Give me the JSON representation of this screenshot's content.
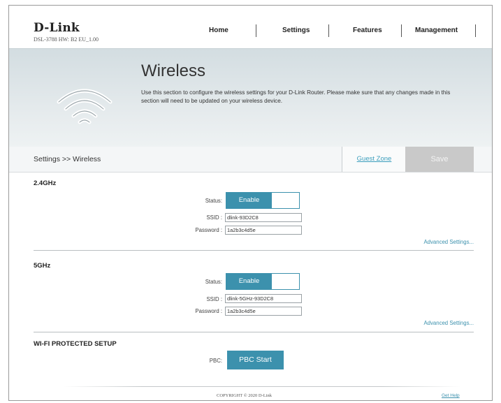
{
  "brand": {
    "logo": "D-Link",
    "model": "DSL-3788  HW: B2  EU_1.00"
  },
  "nav": {
    "items": [
      "Home",
      "Settings",
      "Features",
      "Management"
    ]
  },
  "hero": {
    "title": "Wireless",
    "description": "Use this section to configure the wireless settings for your D-Link Router. Please make sure that any changes made in this section will need to be updated on your wireless device.",
    "icon": "wifi-icon"
  },
  "breadcrumb": "Settings >> Wireless",
  "tabs": {
    "guest_zone": "Guest Zone",
    "save": "Save"
  },
  "band24": {
    "title": "2.4GHz",
    "status_label": "Status:",
    "status_value": "Enable",
    "ssid_label": "SSID :",
    "ssid_value": "dlink-93D2C8",
    "password_label": "Password :",
    "password_value": "1a2b3c4d5e",
    "advanced": "Advanced Settings..."
  },
  "band5": {
    "title": "5GHz",
    "status_label": "Status:",
    "status_value": "Enable",
    "ssid_label": "SSID :",
    "ssid_value": "dlink-5GHz-93D2C8",
    "password_label": "Password :",
    "password_value": "1a2b3c4d5e",
    "advanced": "Advanced Settings..."
  },
  "wps": {
    "title": "WI-FI PROTECTED SETUP",
    "pbc_label": "PBC:",
    "pbc_button": "PBC Start"
  },
  "footer": {
    "copyright": "COPYRIGHT © 2020 D-Link",
    "help": "Get Help"
  },
  "colors": {
    "accent": "#3c91ad",
    "save_disabled": "#c9c9c9"
  }
}
